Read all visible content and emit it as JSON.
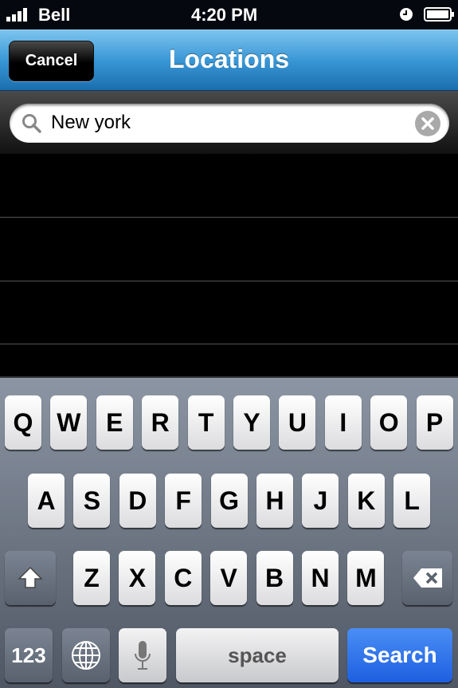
{
  "status": {
    "carrier": "Bell",
    "time": "4:20 PM",
    "signal_bars": 4,
    "battery": "full",
    "icons": [
      "signal-icon",
      "clock-icon",
      "battery-icon"
    ]
  },
  "nav": {
    "title": "Locations",
    "cancel_label": "Cancel"
  },
  "search": {
    "value": "New york",
    "icons": [
      "search-icon",
      "clear-icon"
    ]
  },
  "keyboard": {
    "row1": [
      "Q",
      "W",
      "E",
      "R",
      "T",
      "Y",
      "U",
      "I",
      "O",
      "P"
    ],
    "row2": [
      "A",
      "S",
      "D",
      "F",
      "G",
      "H",
      "J",
      "K",
      "L"
    ],
    "row3": [
      "Z",
      "X",
      "C",
      "V",
      "B",
      "N",
      "M"
    ],
    "numbers_label": "123",
    "space_label": "space",
    "search_label": "Search",
    "icons": [
      "shift-icon",
      "delete-icon",
      "globe-icon",
      "microphone-icon"
    ]
  },
  "colors": {
    "nav": "#3a97d6",
    "search_key": "#2f72ea"
  }
}
